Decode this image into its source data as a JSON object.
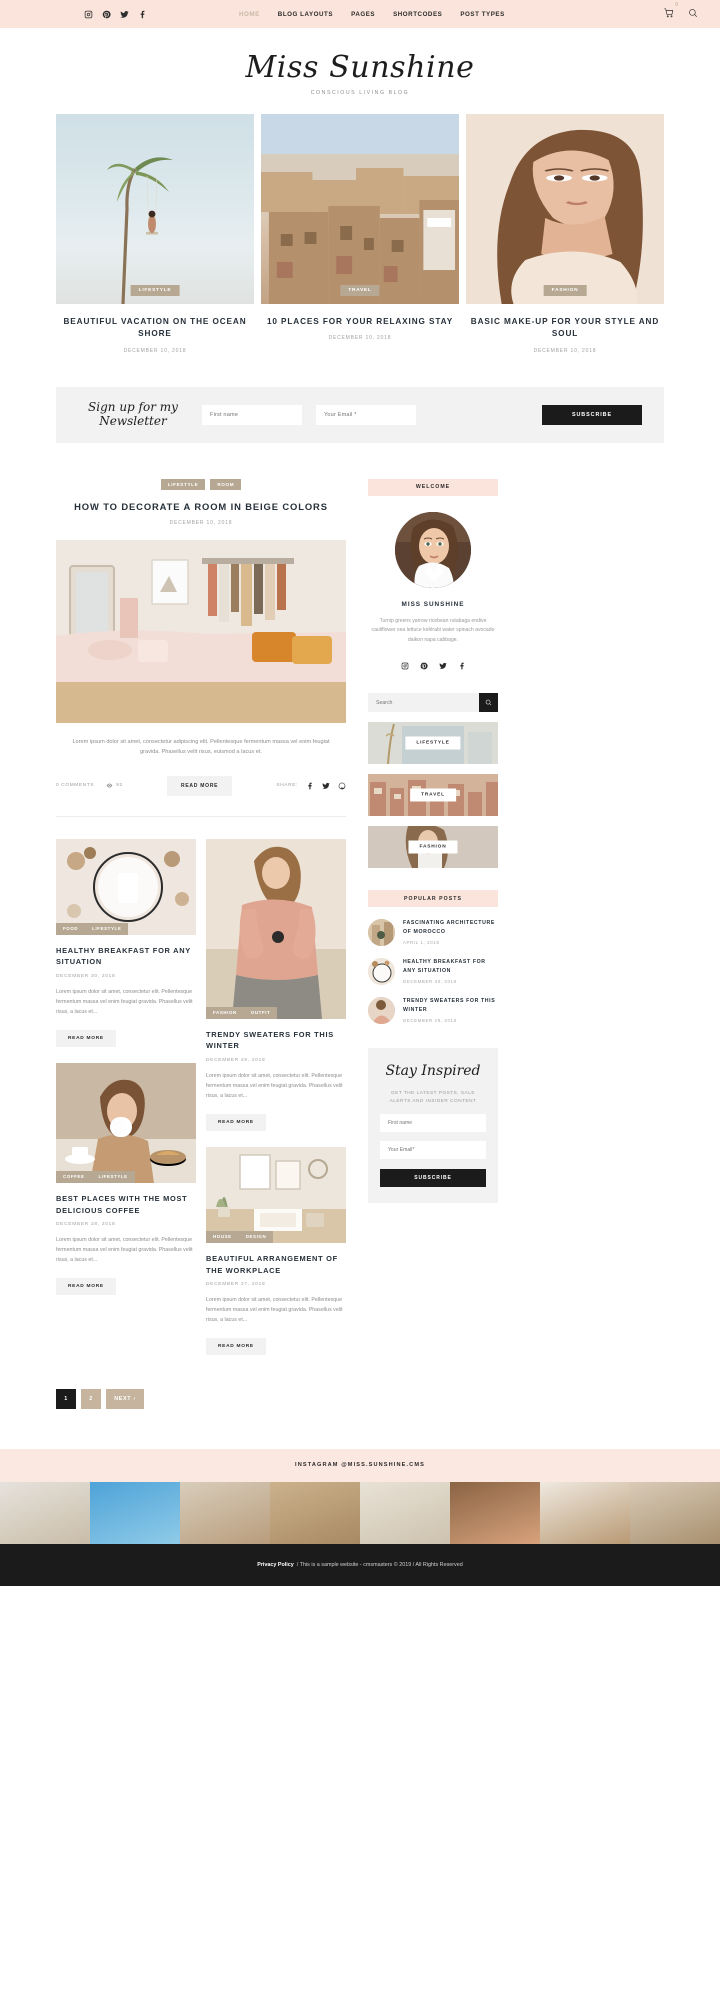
{
  "topbar": {
    "social": [
      "instagram-icon",
      "pinterest-icon",
      "twitter-icon",
      "facebook-icon"
    ],
    "nav": [
      {
        "label": "HOME",
        "active": true
      },
      {
        "label": "BLOG LAYOUTS",
        "active": false
      },
      {
        "label": "PAGES",
        "active": false
      },
      {
        "label": "SHORTCODES",
        "active": false
      },
      {
        "label": "POST TYPES",
        "active": false
      }
    ],
    "cart_count": "0",
    "search_icon": "search-icon"
  },
  "brand": {
    "logo": "Miss Sunshine",
    "tagline": "CONSCIOUS LIVING BLOG"
  },
  "hero": [
    {
      "tag": "LIFESTYLE",
      "title": "BEAUTIFUL VACATION ON THE OCEAN SHORE",
      "date": "DECEMBER 10, 2018",
      "image": "palm-tree-beach-swing"
    },
    {
      "tag": "TRAVEL",
      "title": "10 PLACES FOR YOUR RELAXING STAY",
      "date": "DECEMBER 10, 2018",
      "image": "mediterranean-rooftops"
    },
    {
      "tag": "FASHION",
      "title": "BASIC MAKE-UP FOR YOUR STYLE AND SOUL",
      "date": "DECEMBER 10, 2018",
      "image": "woman-portrait-makeup"
    }
  ],
  "newsletter_bar": {
    "script_line1": "Sign up for my",
    "script_line2": "Newsletter",
    "first_name_placeholder": "First name",
    "email_placeholder": "Your Email *",
    "button": "SUBSCRIBE"
  },
  "featured": {
    "tags": [
      "LIFESTYLE",
      "ROOM"
    ],
    "title": "HOW TO DECORATE A ROOM IN BEIGE COLORS",
    "date": "DECEMBER 10, 2018",
    "image": "beige-bedroom-interior",
    "excerpt": "Lorem ipsum dolor sit amet, consectetur adipiscing elit. Pellentesque fermentum massa vel enim feugiat gravida. Phasellus velit risus, euismod a lacus et.",
    "comments": "0 COMMENTS",
    "views": "92",
    "read_more": "READ MORE",
    "share_label": "SHARE:",
    "share_icons": [
      "facebook-icon",
      "twitter-icon",
      "pinterest-icon"
    ]
  },
  "grid_left": [
    {
      "tags": [
        "FOOD",
        "LIFESTYLE"
      ],
      "title": "HEALTHY BREAKFAST FOR ANY SITUATION",
      "date": "DECEMBER 30, 2018",
      "excerpt": "Lorem ipsum dolor sit amet, consectetur elit. Pellentesque fermentum massa vel enim feugiat gravida. Phasellus velit risus, a lacus et...",
      "read_more": "READ MORE",
      "image": "breakfast-flatlay",
      "img_height": "96"
    },
    {
      "tags": [
        "COFFEE",
        "LIFESTYLE"
      ],
      "title": "BEST PLACES WITH THE MOST DELICIOUS COFFEE",
      "date": "DECEMBER 28, 2018",
      "excerpt": "Lorem ipsum dolor sit amet, consectetur elit. Pellentesque fermentum massa vel enim feugiat gravida. Phasellus velit risus, a lacus et...",
      "read_more": "READ MORE",
      "image": "woman-drinking-coffee-cafe",
      "img_height": "120"
    }
  ],
  "grid_right": [
    {
      "tags": [
        "FASHION",
        "OUTFIT"
      ],
      "title": "TRENDY SWEATERS FOR THIS WINTER",
      "date": "DECEMBER 29, 2018",
      "excerpt": "Lorem ipsum dolor sit amet, consectetur elit. Pellentesque fermentum massa vel enim feugiat gravida. Phasellus velit risus, a lacus et...",
      "read_more": "READ MORE",
      "image": "woman-pink-sweater",
      "img_height": "180"
    },
    {
      "tags": [
        "HOUSE",
        "DESIGN"
      ],
      "title": "BEAUTIFUL ARRANGEMENT OF THE WORKPLACE",
      "date": "DECEMBER 27, 2018",
      "excerpt": "Lorem ipsum dolor sit amet, consectetur elit. Pellentesque fermentum massa vel enim feugiat gravida. Phasellus velit risus, a lacus et...",
      "read_more": "READ MORE",
      "image": "home-office-desk",
      "img_height": "96"
    }
  ],
  "pagination": {
    "pages": [
      "1",
      "2"
    ],
    "current": "1",
    "next": "NEXT ›"
  },
  "sidebar": {
    "welcome_head": "WELCOME",
    "avatar": "miss-sunshine-portrait",
    "name": "MISS SUNSHINE",
    "bio": "Turnip greens yarrow ricebean rutabaga endive cauliflower sea lettuce kohlrabi water spinach avocado daikon napa cabbage.",
    "social": [
      "instagram-icon",
      "pinterest-icon",
      "twitter-icon",
      "facebook-icon"
    ],
    "search_placeholder": "Search",
    "categories": [
      {
        "label": "LIFESTYLE",
        "image": "linen-textiles"
      },
      {
        "label": "TRAVEL",
        "image": "coastal-town-aerial"
      },
      {
        "label": "FASHION",
        "image": "woman-white-sweater"
      }
    ],
    "popular_head": "POPULAR POSTS",
    "popular": [
      {
        "title": "FASCINATING ARCHITECTURE OF MOROCCO",
        "date": "APRIL 1, 2019",
        "thumb": "morocco-architecture"
      },
      {
        "title": "HEALTHY BREAKFAST FOR ANY SITUATION",
        "date": "DECEMBER 30, 2018",
        "thumb": "breakfast-plate"
      },
      {
        "title": "TRENDY SWEATERS FOR THIS WINTER",
        "date": "DECEMBER 29, 2018",
        "thumb": "sweater-detail"
      }
    ],
    "inspire": {
      "script": "Stay Inspired",
      "sub": "GET THE LATEST POSTS, SALE ALERTS AND INSIDER CONTENT",
      "first_name_placeholder": "First name",
      "email_placeholder": "Your Email*",
      "button": "SUBSCRIBE"
    }
  },
  "footer": {
    "instagram_label": "INSTAGRAM @MISS.SUNSHINE.CMS",
    "gallery": [
      "palms-building",
      "palms-sky",
      "beach-sunbathing",
      "straw-hat",
      "white-linen-bag",
      "woman-leopard",
      "hat-flatlay",
      "cafe-woman"
    ],
    "privacy": "Privacy Policy",
    "copyright": "/ This is a sample website - cmsmasters © 2019 / All Rights Reserved"
  },
  "colors": {
    "blush": "#fbe4db",
    "tan": "#b6a893",
    "dark": "#1b1b1b",
    "grey_bg": "#f2f2f2"
  }
}
